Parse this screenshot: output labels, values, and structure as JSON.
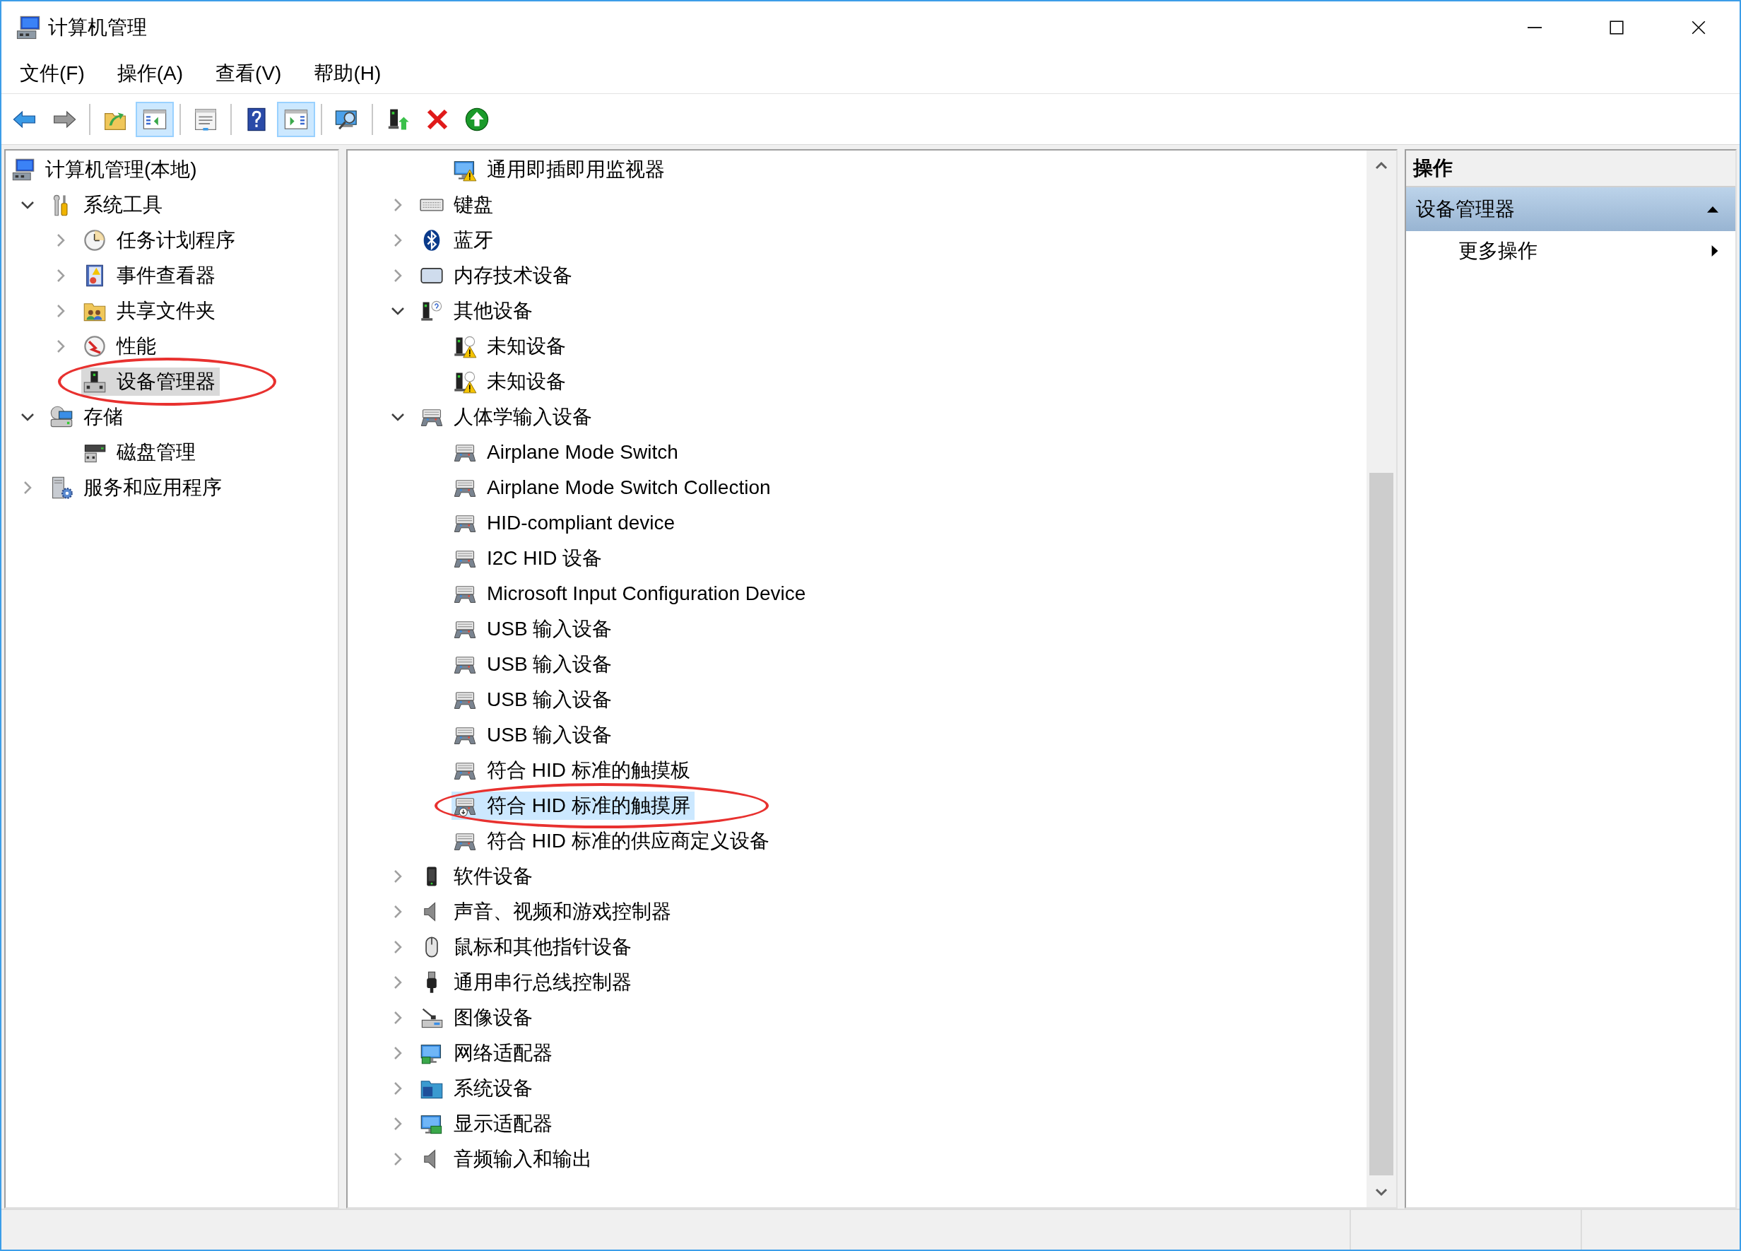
{
  "window": {
    "title": "计算机管理"
  },
  "menu": [
    {
      "label": "文件(F)"
    },
    {
      "label": "操作(A)"
    },
    {
      "label": "查看(V)"
    },
    {
      "label": "帮助(H)"
    }
  ],
  "toolbar": [
    {
      "kind": "back",
      "pressed": false
    },
    {
      "kind": "forward",
      "pressed": false
    },
    {
      "kind": "separator"
    },
    {
      "kind": "up",
      "pressed": false
    },
    {
      "kind": "console-tree",
      "pressed": true
    },
    {
      "kind": "separator"
    },
    {
      "kind": "properties",
      "pressed": false
    },
    {
      "kind": "separator"
    },
    {
      "kind": "help",
      "pressed": false
    },
    {
      "kind": "action-pane",
      "pressed": true
    },
    {
      "kind": "separator"
    },
    {
      "kind": "scan",
      "pressed": false
    },
    {
      "kind": "separator"
    },
    {
      "kind": "update",
      "pressed": false
    },
    {
      "kind": "delete",
      "pressed": false
    },
    {
      "kind": "enable",
      "pressed": false
    }
  ],
  "nav_tree": {
    "label": "计算机管理(本地)",
    "kind": "computer",
    "selected": false,
    "circled": false,
    "children": [
      {
        "label": "系统工具",
        "kind": "tools",
        "expandable": true,
        "expanded": true,
        "selected": false,
        "circled": false,
        "children": [
          {
            "label": "任务计划程序",
            "kind": "clock",
            "expandable": true,
            "expanded": false,
            "selected": false,
            "circled": false
          },
          {
            "label": "事件查看器",
            "kind": "eventlog",
            "expandable": true,
            "expanded": false,
            "selected": false,
            "circled": false
          },
          {
            "label": "共享文件夹",
            "kind": "share",
            "expandable": true,
            "expanded": false,
            "selected": false,
            "circled": false
          },
          {
            "label": "性能",
            "kind": "perf",
            "expandable": true,
            "expanded": false,
            "selected": false,
            "circled": false
          },
          {
            "label": "设备管理器",
            "kind": "device",
            "expandable": false,
            "selected": true,
            "circled": true
          }
        ]
      },
      {
        "label": "存储",
        "kind": "storage",
        "expandable": true,
        "expanded": true,
        "selected": false,
        "circled": false,
        "children": [
          {
            "label": "磁盘管理",
            "kind": "disk",
            "expandable": false,
            "selected": false,
            "circled": false
          }
        ]
      },
      {
        "label": "服务和应用程序",
        "kind": "services",
        "expandable": true,
        "expanded": false,
        "selected": false,
        "circled": false
      }
    ]
  },
  "device_tree": {
    "continued_children": [
      {
        "label": "通用即插即用监视器",
        "kind": "monitor-warning",
        "expandable": false,
        "selected": false,
        "circled": false
      }
    ],
    "items": [
      {
        "label": "键盘",
        "kind": "keyboard",
        "expandable": true,
        "expanded": false,
        "selected": false,
        "circled": false
      },
      {
        "label": "蓝牙",
        "kind": "bluetooth",
        "expandable": true,
        "expanded": false,
        "selected": false,
        "circled": false
      },
      {
        "label": "内存技术设备",
        "kind": "memory",
        "expandable": true,
        "expanded": false,
        "selected": false,
        "circled": false
      },
      {
        "label": "其他设备",
        "kind": "unknown",
        "expandable": true,
        "expanded": true,
        "selected": false,
        "circled": false,
        "children": [
          {
            "label": "未知设备",
            "kind": "unknown-warning",
            "expandable": false,
            "selected": false,
            "circled": false
          },
          {
            "label": "未知设备",
            "kind": "unknown-warning",
            "expandable": false,
            "selected": false,
            "circled": false
          }
        ]
      },
      {
        "label": "人体学输入设备",
        "kind": "hid",
        "expandable": true,
        "expanded": true,
        "selected": false,
        "circled": false,
        "children": [
          {
            "label": "Airplane Mode Switch",
            "kind": "hid",
            "expandable": false,
            "selected": false,
            "circled": false
          },
          {
            "label": "Airplane Mode Switch Collection",
            "kind": "hid",
            "expandable": false,
            "selected": false,
            "circled": false
          },
          {
            "label": "HID-compliant device",
            "kind": "hid",
            "expandable": false,
            "selected": false,
            "circled": false
          },
          {
            "label": "I2C HID 设备",
            "kind": "hid",
            "expandable": false,
            "selected": false,
            "circled": false
          },
          {
            "label": "Microsoft Input Configuration Device",
            "kind": "hid",
            "expandable": false,
            "selected": false,
            "circled": false
          },
          {
            "label": "USB 输入设备",
            "kind": "hid",
            "expandable": false,
            "selected": false,
            "circled": false
          },
          {
            "label": "USB 输入设备",
            "kind": "hid",
            "expandable": false,
            "selected": false,
            "circled": false
          },
          {
            "label": "USB 输入设备",
            "kind": "hid",
            "expandable": false,
            "selected": false,
            "circled": false
          },
          {
            "label": "USB 输入设备",
            "kind": "hid",
            "expandable": false,
            "selected": false,
            "circled": false
          },
          {
            "label": "符合 HID 标准的触摸板",
            "kind": "hid",
            "expandable": false,
            "selected": false,
            "circled": false
          },
          {
            "label": "符合 HID 标准的触摸屏",
            "kind": "hid-touch",
            "expandable": false,
            "selected": true,
            "circled": true
          },
          {
            "label": "符合 HID 标准的供应商定义设备",
            "kind": "hid",
            "expandable": false,
            "selected": false,
            "circled": false
          }
        ]
      },
      {
        "label": "软件设备",
        "kind": "software",
        "expandable": true,
        "expanded": false,
        "selected": false,
        "circled": false
      },
      {
        "label": "声音、视频和游戏控制器",
        "kind": "speaker",
        "expandable": true,
        "expanded": false,
        "selected": false,
        "circled": false
      },
      {
        "label": "鼠标和其他指针设备",
        "kind": "mouse",
        "expandable": true,
        "expanded": false,
        "selected": false,
        "circled": false
      },
      {
        "label": "通用串行总线控制器",
        "kind": "usb",
        "expandable": true,
        "expanded": false,
        "selected": false,
        "circled": false
      },
      {
        "label": "图像设备",
        "kind": "imaging",
        "expandable": true,
        "expanded": false,
        "selected": false,
        "circled": false
      },
      {
        "label": "网络适配器",
        "kind": "network",
        "expandable": true,
        "expanded": false,
        "selected": false,
        "circled": false
      },
      {
        "label": "系统设备",
        "kind": "system",
        "expandable": true,
        "expanded": false,
        "selected": false,
        "circled": false
      },
      {
        "label": "显示适配器",
        "kind": "display",
        "expandable": true,
        "expanded": false,
        "selected": false,
        "circled": false
      },
      {
        "label": "音频输入和输出",
        "kind": "speaker",
        "expandable": true,
        "expanded": false,
        "selected": false,
        "circled": false
      }
    ]
  },
  "actions": {
    "title": "操作",
    "sections": [
      {
        "label": "设备管理器",
        "expanded": true,
        "items": [
          {
            "label": "更多操作",
            "has_submenu": true
          }
        ]
      }
    ]
  }
}
